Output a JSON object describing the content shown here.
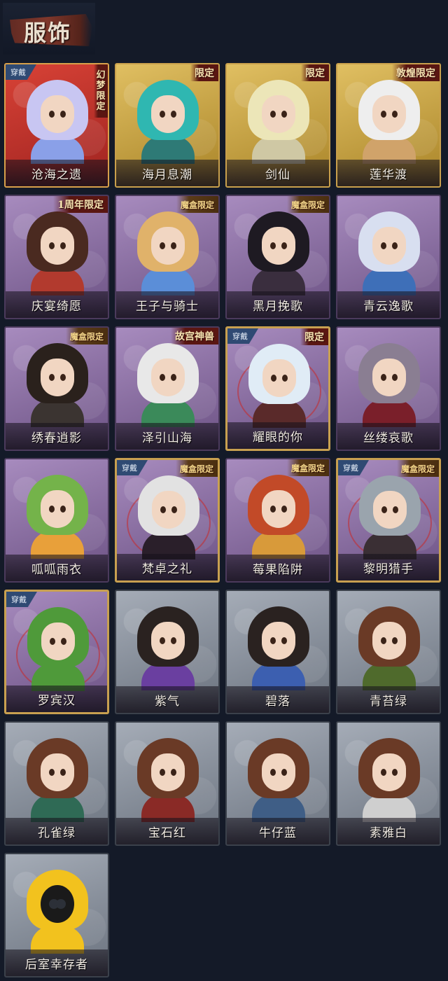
{
  "header": {
    "title": "服饰"
  },
  "worn_label": "穿戴",
  "costumes": [
    {
      "name": "沧海之遗",
      "theme": "red",
      "worn": true,
      "tag": "幻梦限定",
      "tag_style": "vertical",
      "hair": "#c8c6f2",
      "outfit": "#8aa0e8"
    },
    {
      "name": "海月息潮",
      "theme": "gold",
      "worn": false,
      "tag": "限定",
      "tag_style": "normal",
      "hair": "#2fb7b1",
      "outfit": "#2e7a76"
    },
    {
      "name": "剑仙",
      "theme": "gold",
      "worn": false,
      "tag": "限定",
      "tag_style": "normal",
      "hair": "#ece6b8",
      "outfit": "#cfc8a4"
    },
    {
      "name": "莲华渡",
      "theme": "gold",
      "worn": false,
      "tag": "敦煌限定",
      "tag_style": "normal",
      "hair": "#eeeeee",
      "outfit": "#d0a36a"
    },
    {
      "name": "庆宴绮愿",
      "theme": "purple",
      "worn": false,
      "tag": "1周年限定",
      "tag_style": "normal",
      "hair": "#4a2a20",
      "outfit": "#b23a2e"
    },
    {
      "name": "王子与骑士",
      "theme": "purple",
      "worn": false,
      "tag": "魔盒限定",
      "tag_style": "box",
      "hair": "#e0b26a",
      "outfit": "#5b8ed8"
    },
    {
      "name": "黑月挽歌",
      "theme": "purple",
      "worn": false,
      "tag": "魔盒限定",
      "tag_style": "box",
      "hair": "#1e1a22",
      "outfit": "#3a2e3e"
    },
    {
      "name": "青云逸歌",
      "theme": "purple",
      "worn": false,
      "tag": "",
      "tag_style": "none",
      "hair": "#d8dff0",
      "outfit": "#3e6fb8"
    },
    {
      "name": "绣春逍影",
      "theme": "purple",
      "worn": false,
      "tag": "魔盒限定",
      "tag_style": "box",
      "hair": "#2a211c",
      "outfit": "#3b3431"
    },
    {
      "name": "泽引山海",
      "theme": "purple",
      "worn": false,
      "tag": "故宫神兽",
      "tag_style": "normal",
      "hair": "#e8e8e8",
      "outfit": "#3b8a5a"
    },
    {
      "name": "耀眼的你",
      "theme": "purple",
      "worn": true,
      "tag": "限定",
      "tag_style": "normal",
      "hair": "#e0ecf6",
      "outfit": "#5a2a2a"
    },
    {
      "name": "丝缕哀歌",
      "theme": "purple",
      "worn": false,
      "tag": "",
      "tag_style": "none",
      "hair": "#8a7e92",
      "outfit": "#7a1f2a"
    },
    {
      "name": "呱呱雨衣",
      "theme": "purple",
      "worn": false,
      "tag": "",
      "tag_style": "none",
      "hair": "#74b34a",
      "outfit": "#e8a03a"
    },
    {
      "name": "梵卓之礼",
      "theme": "purple",
      "worn": true,
      "tag": "魔盒限定",
      "tag_style": "box",
      "hair": "#e2e2e2",
      "outfit": "#2a1f2a"
    },
    {
      "name": "莓果陷阱",
      "theme": "purple",
      "worn": false,
      "tag": "魔盒限定",
      "tag_style": "box",
      "hair": "#c24a28",
      "outfit": "#d89a3a"
    },
    {
      "name": "黎明猎手",
      "theme": "purple",
      "worn": true,
      "tag": "魔盒限定",
      "tag_style": "box",
      "hair": "#9aa4ad",
      "outfit": "#3a2f34"
    },
    {
      "name": "罗宾汉",
      "theme": "purple",
      "worn": true,
      "tag": "",
      "tag_style": "none",
      "hair": "#4f9a3a",
      "outfit": "#4f9a3a"
    },
    {
      "name": "紫气",
      "theme": "gray",
      "worn": false,
      "tag": "",
      "tag_style": "none",
      "hair": "#2a2220",
      "outfit": "#6a3fa0"
    },
    {
      "name": "碧落",
      "theme": "gray",
      "worn": false,
      "tag": "",
      "tag_style": "none",
      "hair": "#2a2220",
      "outfit": "#3c5fb0"
    },
    {
      "name": "青苔绿",
      "theme": "gray",
      "worn": false,
      "tag": "",
      "tag_style": "none",
      "hair": "#6a3a26",
      "outfit": "#4f6a2c"
    },
    {
      "name": "孔雀绿",
      "theme": "gray",
      "worn": false,
      "tag": "",
      "tag_style": "none",
      "hair": "#6a3a26",
      "outfit": "#2f6a55"
    },
    {
      "name": "宝石红",
      "theme": "gray",
      "worn": false,
      "tag": "",
      "tag_style": "none",
      "hair": "#6a3a26",
      "outfit": "#8a2a26"
    },
    {
      "name": "牛仔蓝",
      "theme": "gray",
      "worn": false,
      "tag": "",
      "tag_style": "none",
      "hair": "#6a3a26",
      "outfit": "#3f5e86"
    },
    {
      "name": "素雅白",
      "theme": "gray",
      "worn": false,
      "tag": "",
      "tag_style": "none",
      "hair": "#6a3a26",
      "outfit": "#cfcfcf"
    },
    {
      "name": "后室幸存者",
      "theme": "gray",
      "worn": false,
      "tag": "",
      "tag_style": "none",
      "hair": "#f2c21e",
      "outfit": "#f2c21e",
      "masked": true
    }
  ]
}
